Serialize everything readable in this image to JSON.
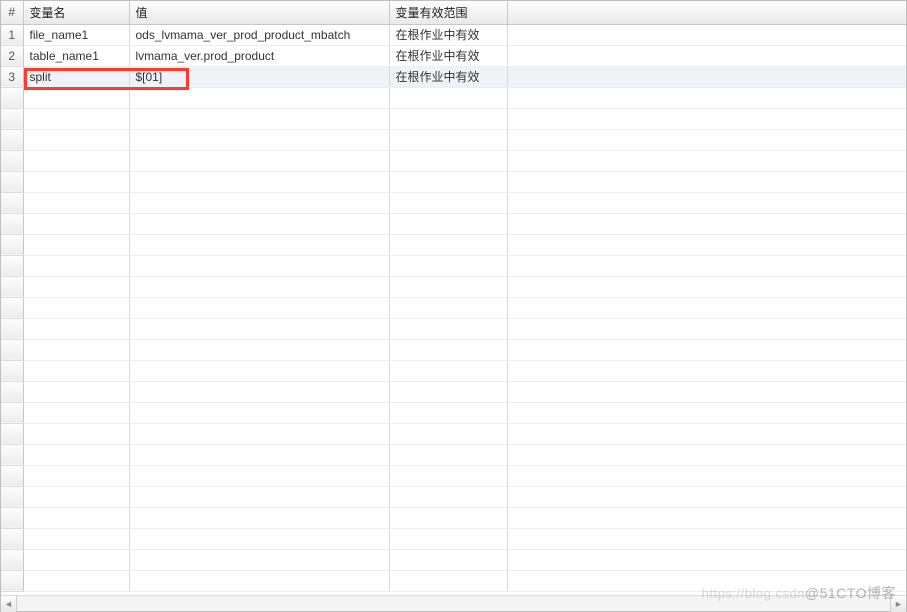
{
  "columns": {
    "num": "#",
    "name": "变量名",
    "value": "值",
    "scope": "变量有效范围"
  },
  "rows": [
    {
      "num": "1",
      "name": "file_name1",
      "value": "ods_lvmama_ver_prod_product_mbatch",
      "scope": "在根作业中有效"
    },
    {
      "num": "2",
      "name": "table_name1",
      "value": "lvmama_ver.prod_product",
      "scope": "在根作业中有效"
    },
    {
      "num": "3",
      "name": "split",
      "value": "$[01]",
      "scope": "在根作业中有效"
    }
  ],
  "watermark": {
    "prefix": "https://blog.csdn",
    "suffix": "@51CTO博客"
  },
  "highlight_row_index": 2
}
